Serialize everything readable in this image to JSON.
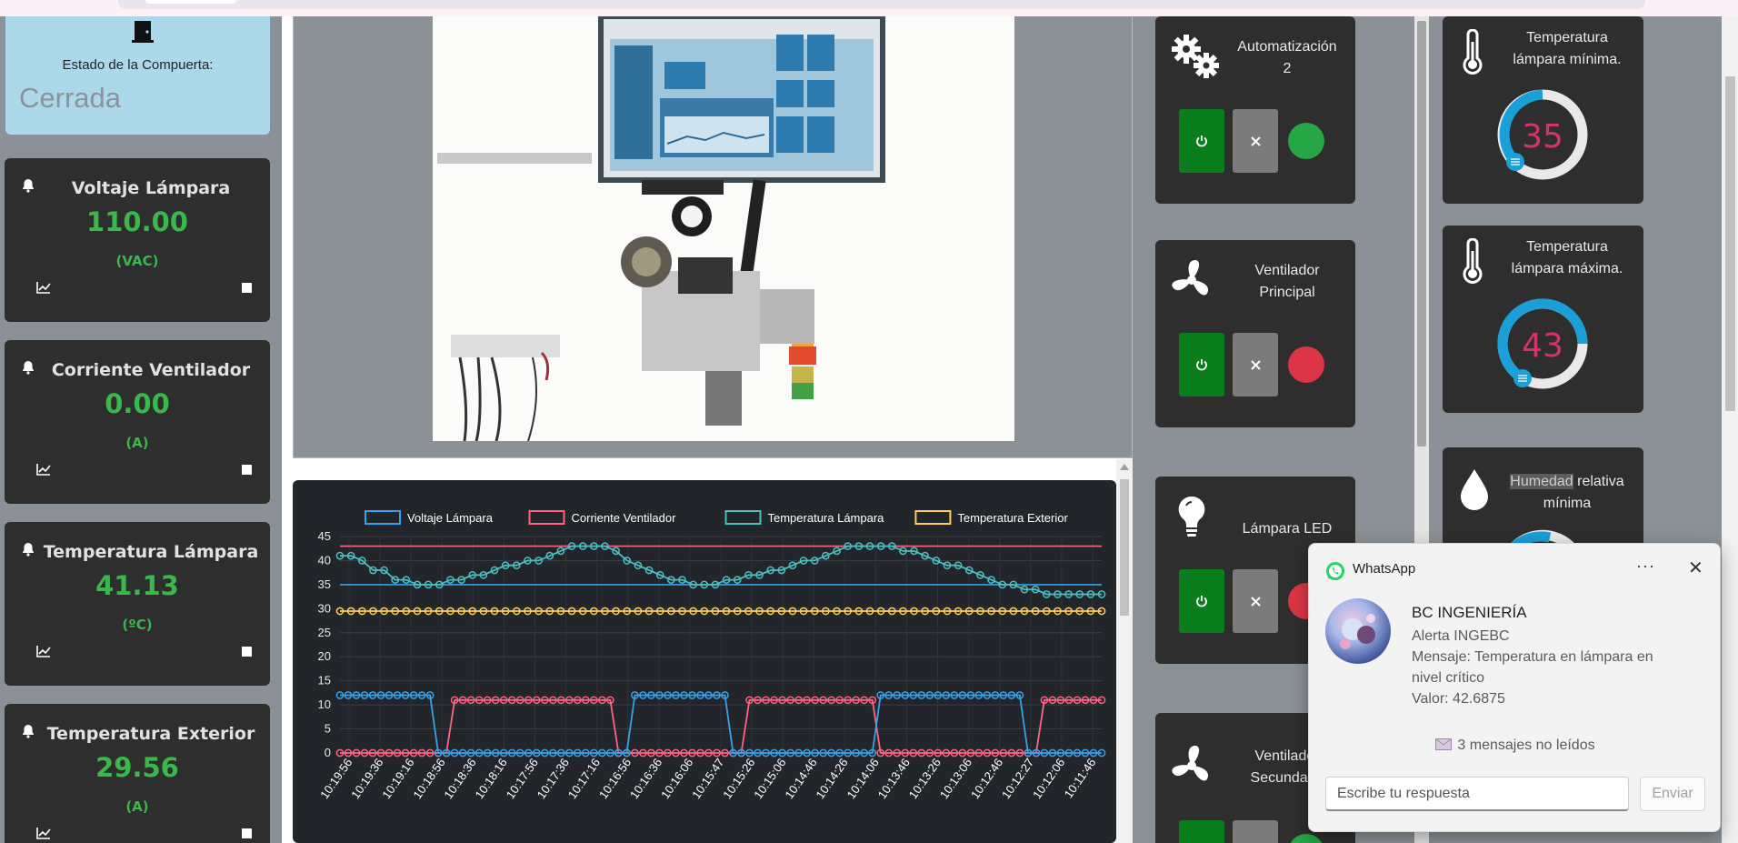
{
  "gate": {
    "label": "Estado de la Compuerta:",
    "status": "Cerrada"
  },
  "sensors": [
    {
      "title": "Voltaje Lámpara",
      "value": "110.00",
      "unit": "(VAC)"
    },
    {
      "title": "Corriente Ventilador",
      "value": "0.00",
      "unit": "(A)"
    },
    {
      "title": "Temperatura Lámpara",
      "value": "41.13",
      "unit": "(ºC)"
    },
    {
      "title": "Temperatura Exterior",
      "value": "29.56",
      "unit": "(A)"
    }
  ],
  "controls": [
    {
      "label_line1": "Automatización",
      "label_line2": "2",
      "icon": "gears-icon",
      "led": "#25a745"
    },
    {
      "label_line1": "Ventilador",
      "label_line2": "Principal",
      "icon": "fan-icon",
      "led": "#dc3545"
    },
    {
      "label_line1": "Lámpara LED",
      "label_line2": "",
      "icon": "lightbulb-icon",
      "led": "#dc3545"
    },
    {
      "label_line1": "Ventilador",
      "label_line2": "Secundario",
      "icon": "fan-icon",
      "led": "#25a745"
    }
  ],
  "gauges": [
    {
      "label_line1": "Temperatura",
      "label_line2": "lámpara mínima.",
      "value": "35",
      "icon": "thermometer-icon"
    },
    {
      "label_line1": "Temperatura",
      "label_line2": "lámpara máxima.",
      "value": "43",
      "icon": "thermometer-icon"
    },
    {
      "label_highlight": "Humedad",
      "label_rest": " relativa",
      "label_line2": "mínima",
      "icon": "droplet-icon"
    }
  ],
  "colors": {
    "accent_green": "#38b94a",
    "gauge_value": "#d6336c",
    "gauge_arc": "#1a9fd9"
  },
  "notification": {
    "app": "WhatsApp",
    "sender": "BC INGENIERÍA",
    "line1": "Alerta INGEBC",
    "line2": "Mensaje: Temperatura en lámpara  en",
    "line3": "nivel crítico",
    "line4": "Valor: 42.6875",
    "unread": "3 mensajes no leídos",
    "reply_placeholder": "Escribe tu respuesta",
    "send_label": "Enviar"
  },
  "chart_data": {
    "type": "line",
    "y_ticks": [
      "45",
      "40",
      "35",
      "30",
      "25",
      "20",
      "15",
      "10",
      "5",
      "0"
    ],
    "ylim": [
      0,
      45
    ],
    "grid": true,
    "legend_position": "top",
    "x": [
      "10:19:56",
      "10:19:36",
      "10:19:16",
      "10:18:56",
      "10:18:36",
      "10:18:16",
      "10:17:56",
      "10:17:36",
      "10:17:16",
      "10:16:56",
      "10:16:36",
      "10:16:06",
      "10:15:47",
      "10:15:26",
      "10:15:06",
      "10:14:46",
      "10:14:26",
      "10:14:06",
      "10:13:46",
      "10:13:26",
      "10:13:06",
      "10:12:46",
      "10:12:27",
      "10:12:06",
      "10:11:46"
    ],
    "series": [
      {
        "name": "Voltaje Lámpara",
        "color": "#36a2eb"
      },
      {
        "name": "Corriente Ventilador",
        "color": "#ff6384"
      },
      {
        "name": "Temperatura Lámpara",
        "color": "#4bc0c0"
      },
      {
        "name": "Temperatura Exterior",
        "color": "#ffcd56"
      }
    ],
    "description_values": {
      "voltaje_line": 35,
      "corriente_line": 43,
      "temperatura_lampara": [
        41,
        41,
        40,
        38,
        38,
        36,
        36,
        35,
        35,
        35,
        36,
        36,
        37,
        37,
        38,
        39,
        39,
        40,
        40,
        41,
        42,
        43,
        43,
        43,
        43,
        42,
        40,
        39,
        38,
        37,
        36,
        36,
        35,
        35,
        35,
        36,
        36,
        37,
        37,
        38,
        38,
        39,
        40,
        40,
        41,
        42,
        43,
        43,
        43,
        43,
        43,
        42,
        42,
        41,
        40,
        39,
        39,
        38,
        37,
        36,
        35,
        35,
        34,
        34,
        33,
        33,
        33,
        33,
        33,
        33
      ],
      "temperatura_exterior": 29.5,
      "voltaje_pts": [
        12,
        12,
        12,
        12,
        12,
        12,
        12,
        12,
        12,
        12,
        12,
        12,
        0,
        0,
        0,
        0,
        0,
        0,
        0,
        0,
        0,
        0,
        0,
        0,
        0,
        0,
        0,
        0,
        0,
        0,
        0,
        0,
        0,
        0,
        0,
        0,
        12,
        12,
        12,
        12,
        12,
        12,
        12,
        12,
        12,
        12,
        12,
        12,
        0,
        0,
        0,
        0,
        0,
        0,
        0,
        0,
        0,
        0,
        0,
        0,
        0,
        0,
        0,
        0,
        0,
        0,
        12,
        12,
        12,
        12,
        12,
        12,
        12,
        12,
        12,
        12,
        12,
        12,
        12,
        12,
        12,
        12,
        12,
        12,
        0,
        0,
        0,
        0,
        0,
        0,
        0,
        0,
        0,
        0
      ],
      "corriente_pts": [
        0,
        0,
        0,
        0,
        0,
        0,
        0,
        0,
        0,
        0,
        0,
        0,
        0,
        0,
        11,
        11,
        11,
        11,
        11,
        11,
        11,
        11,
        11,
        11,
        11,
        11,
        11,
        11,
        11,
        11,
        11,
        11,
        11,
        11,
        0,
        0,
        0,
        0,
        0,
        0,
        0,
        0,
        0,
        0,
        0,
        0,
        0,
        0,
        0,
        0,
        11,
        11,
        11,
        11,
        11,
        11,
        11,
        11,
        11,
        11,
        11,
        11,
        11,
        11,
        11,
        11,
        0,
        0,
        0,
        0,
        0,
        0,
        0,
        0,
        0,
        0,
        0,
        0,
        0,
        0,
        0,
        0,
        0,
        0,
        0,
        0,
        11,
        11,
        11,
        11,
        11,
        11,
        11,
        11
      ]
    }
  }
}
